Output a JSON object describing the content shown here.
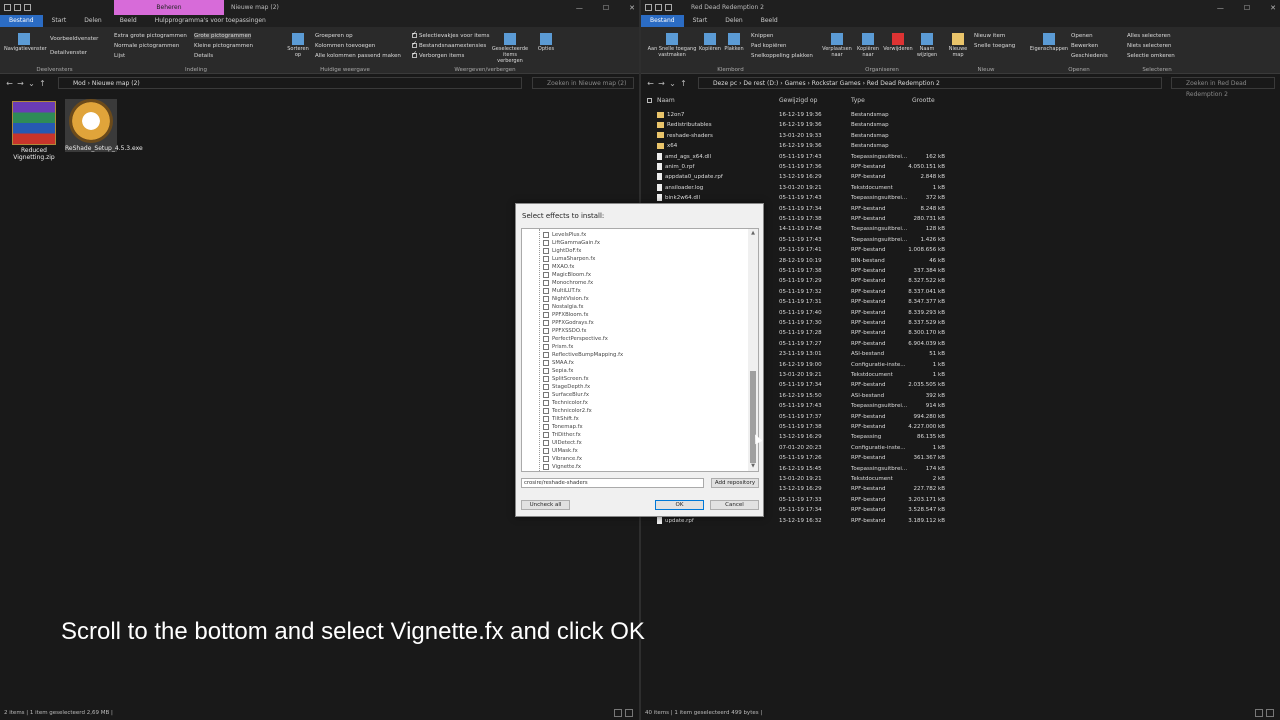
{
  "left": {
    "title": "Nieuwe map (2)",
    "context_tab": "Beheren",
    "tabs": [
      "Bestand",
      "Start",
      "Delen",
      "Beeld",
      "Hulpprogramma's voor toepassingen"
    ],
    "ribbon": {
      "navpane": "Navigatievenster",
      "preview": "Voorbeeldvenster",
      "details_pane": "Detailvenster",
      "layout_items": [
        "Extra grote pictogrammen",
        "Grote pictogrammen",
        "Normale pictogrammen",
        "Kleine pictogrammen",
        "Lijst",
        "Details"
      ],
      "sort": "Sorteren op",
      "group_by": "Groeperen op",
      "add_columns": "Kolommen toevoegen",
      "fit_columns": "Alle kolommen passend maken",
      "checkboxes": "Selectievakjes voor items",
      "extensions": "Bestandsnaamextensies",
      "hidden": "Verborgen items",
      "hide_selected": "Geselecteerde items verbergen",
      "options": "Opties",
      "groups": [
        "Deelvensters",
        "Indeling",
        "Huidige weergave",
        "Weergeven/verbergen"
      ]
    },
    "address": [
      "Mod",
      "Nieuwe map (2)"
    ],
    "search_placeholder": "Zoeken in Nieuwe map (2)",
    "icons": [
      {
        "label": "Reduced Vignetting.zip"
      },
      {
        "label": "ReShade_Setup_4.5.3.exe"
      }
    ],
    "status": "2 items  |  1 item geselecteerd  2,69 MB  |"
  },
  "right": {
    "title": "Red Dead Redemption 2",
    "tabs": [
      "Bestand",
      "Start",
      "Delen",
      "Beeld"
    ],
    "ribbon": {
      "pin": "Aan Snelle toegang vastmaken",
      "copy": "Kopiëren",
      "paste": "Plakken",
      "cut": "Knippen",
      "copy_path": "Pad kopiëren",
      "paste_shortcut": "Snelkoppeling plakken",
      "move_to": "Verplaatsen naar",
      "copy_to": "Kopiëren naar",
      "delete": "Verwijderen",
      "rename": "Naam wijzigen",
      "new_folder": "Nieuwe map",
      "new_item": "Nieuw item",
      "easy_access": "Snelle toegang",
      "properties": "Eigenschappen",
      "open": "Openen",
      "edit": "Bewerken",
      "history": "Geschiedenis",
      "select_all": "Alles selecteren",
      "select_none": "Niets selecteren",
      "invert": "Selectie omkeren",
      "groups": [
        "Klembord",
        "Organiseren",
        "Nieuw",
        "Openen",
        "Selecteren"
      ]
    },
    "address": [
      "Deze pc",
      "De rest (D:)",
      "Games",
      "Rockstar Games",
      "Red Dead Redemption 2"
    ],
    "search_placeholder": "Zoeken in Red Dead Redemption 2",
    "columns": [
      "Naam",
      "Gewijzigd op",
      "Type",
      "Grootte"
    ],
    "files": [
      {
        "name": "12on7",
        "date": "16-12-19 19:36",
        "type": "Bestandsmap",
        "size": "",
        "folder": true
      },
      {
        "name": "Redistributables",
        "date": "16-12-19 19:36",
        "type": "Bestandsmap",
        "size": "",
        "folder": true
      },
      {
        "name": "reshade-shaders",
        "date": "13-01-20 19:33",
        "type": "Bestandsmap",
        "size": "",
        "folder": true
      },
      {
        "name": "x64",
        "date": "16-12-19 19:36",
        "type": "Bestandsmap",
        "size": "",
        "folder": true
      },
      {
        "name": "amd_ags_x64.dll",
        "date": "05-11-19 17:43",
        "type": "Toepassingsuitbrei...",
        "size": "162 kB",
        "folder": false
      },
      {
        "name": "anim_0.rpf",
        "date": "05-11-19 17:36",
        "type": "RPF-bestand",
        "size": "4.050.151 kB",
        "folder": false
      },
      {
        "name": "appdata0_update.rpf",
        "date": "13-12-19 16:29",
        "type": "RPF-bestand",
        "size": "2.848 kB",
        "folder": false
      },
      {
        "name": "ansiloader.log",
        "date": "13-01-20 19:21",
        "type": "Tekstdocument",
        "size": "1 kB",
        "folder": false
      },
      {
        "name": "bink2w64.dll",
        "date": "05-11-19 17:43",
        "type": "Toepassingsuitbrei...",
        "size": "372 kB",
        "folder": false
      },
      {
        "name": "",
        "date": "05-11-19 17:34",
        "type": "RPF-bestand",
        "size": "8.248 kB",
        "folder": false
      },
      {
        "name": "",
        "date": "05-11-19 17:38",
        "type": "RPF-bestand",
        "size": "280.731 kB",
        "folder": false
      },
      {
        "name": "",
        "date": "14-11-19 17:48",
        "type": "Toepassingsuitbrei...",
        "size": "128 kB",
        "folder": false
      },
      {
        "name": "",
        "date": "05-11-19 17:43",
        "type": "Toepassingsuitbrei...",
        "size": "1.426 kB",
        "folder": false
      },
      {
        "name": "",
        "date": "05-11-19 17:41",
        "type": "RPF-bestand",
        "size": "1.008.656 kB",
        "folder": false
      },
      {
        "name": "",
        "date": "28-12-19 10:19",
        "type": "BIN-bestand",
        "size": "46 kB",
        "folder": false
      },
      {
        "name": "",
        "date": "05-11-19 17:38",
        "type": "RPF-bestand",
        "size": "337.384 kB",
        "folder": false
      },
      {
        "name": "",
        "date": "05-11-19 17:29",
        "type": "RPF-bestand",
        "size": "8.327.522 kB",
        "folder": false
      },
      {
        "name": "",
        "date": "05-11-19 17:32",
        "type": "RPF-bestand",
        "size": "8.337.041 kB",
        "folder": false
      },
      {
        "name": "",
        "date": "05-11-19 17:31",
        "type": "RPF-bestand",
        "size": "8.347.377 kB",
        "folder": false
      },
      {
        "name": "",
        "date": "05-11-19 17:40",
        "type": "RPF-bestand",
        "size": "8.339.293 kB",
        "folder": false
      },
      {
        "name": "",
        "date": "05-11-19 17:30",
        "type": "RPF-bestand",
        "size": "8.337.529 kB",
        "folder": false
      },
      {
        "name": "",
        "date": "05-11-19 17:28",
        "type": "RPF-bestand",
        "size": "8.300.170 kB",
        "folder": false
      },
      {
        "name": "",
        "date": "05-11-19 17:27",
        "type": "RPF-bestand",
        "size": "6.904.039 kB",
        "folder": false
      },
      {
        "name": "",
        "date": "23-11-19 13:01",
        "type": "ASI-bestand",
        "size": "51 kB",
        "folder": false
      },
      {
        "name": "",
        "date": "16-12-19 19:00",
        "type": "Configuratie-inste...",
        "size": "1 kB",
        "folder": false
      },
      {
        "name": "",
        "date": "13-01-20 19:21",
        "type": "Tekstdocument",
        "size": "1 kB",
        "folder": false
      },
      {
        "name": "",
        "date": "05-11-19 17:34",
        "type": "RPF-bestand",
        "size": "2.035.505 kB",
        "folder": false
      },
      {
        "name": "",
        "date": "16-12-19 15:50",
        "type": "ASI-bestand",
        "size": "392 kB",
        "folder": false
      },
      {
        "name": "",
        "date": "05-11-19 17:43",
        "type": "Toepassingsuitbrei...",
        "size": "914 kB",
        "folder": false
      },
      {
        "name": "",
        "date": "05-11-19 17:37",
        "type": "RPF-bestand",
        "size": "994.280 kB",
        "folder": false
      },
      {
        "name": "",
        "date": "05-11-19 17:38",
        "type": "RPF-bestand",
        "size": "4.227.000 kB",
        "folder": false
      },
      {
        "name": "",
        "date": "13-12-19 16:29",
        "type": "Toepassing",
        "size": "86.135 kB",
        "folder": false
      },
      {
        "name": "",
        "date": "07-01-20 20:23",
        "type": "Configuratie-inste...",
        "size": "1 kB",
        "folder": false
      },
      {
        "name": "",
        "date": "05-11-19 17:26",
        "type": "RPF-bestand",
        "size": "361.367 kB",
        "folder": false
      },
      {
        "name": "",
        "date": "16-12-19 15:45",
        "type": "Toepassingsuitbrei...",
        "size": "174 kB",
        "folder": false
      },
      {
        "name": "",
        "date": "13-01-20 19:21",
        "type": "Tekstdocument",
        "size": "2 kB",
        "folder": false
      },
      {
        "name": "",
        "date": "13-12-19 16:29",
        "type": "RPF-bestand",
        "size": "227.782 kB",
        "folder": false
      },
      {
        "name": "",
        "date": "05-11-19 17:33",
        "type": "RPF-bestand",
        "size": "3.203.171 kB",
        "folder": false
      },
      {
        "name": "",
        "date": "05-11-19 17:34",
        "type": "RPF-bestand",
        "size": "3.528.547 kB",
        "folder": false
      },
      {
        "name": "update.rpf",
        "date": "13-12-19 16:32",
        "type": "RPF-bestand",
        "size": "3.189.112 kB",
        "folder": false
      }
    ],
    "status": "40 items  |  1 item geselecteerd  499 bytes  |"
  },
  "dialog": {
    "title": "Select effects to install:",
    "effects": [
      "LevelsPlus.fx",
      "LiftGammaGain.fx",
      "LightDoF.fx",
      "LumaSharpen.fx",
      "MXAO.fx",
      "MagicBloom.fx",
      "Monochrome.fx",
      "MultiLUT.fx",
      "NightVision.fx",
      "Nostalgia.fx",
      "PPFXBloom.fx",
      "PPFXGodrays.fx",
      "PPFXSSDO.fx",
      "PerfectPerspective.fx",
      "Prism.fx",
      "ReflectiveBumpMapping.fx",
      "SMAA.fx",
      "Sepia.fx",
      "SplitScreen.fx",
      "StageDepth.fx",
      "SurfaceBlur.fx",
      "Technicolor.fx",
      "Technicolor2.fx",
      "TiltShift.fx",
      "Tonemap.fx",
      "TriDither.fx",
      "UIDetect.fx",
      "UIMask.fx",
      "Vibrance.fx",
      "Vignette.fx"
    ],
    "repo_value": "crosire/reshade-shaders",
    "add_repo": "Add repository",
    "uncheck_all": "Uncheck all",
    "ok": "OK",
    "cancel": "Cancel"
  },
  "caption": "Scroll to the bottom and select Vignette.fx and click OK"
}
